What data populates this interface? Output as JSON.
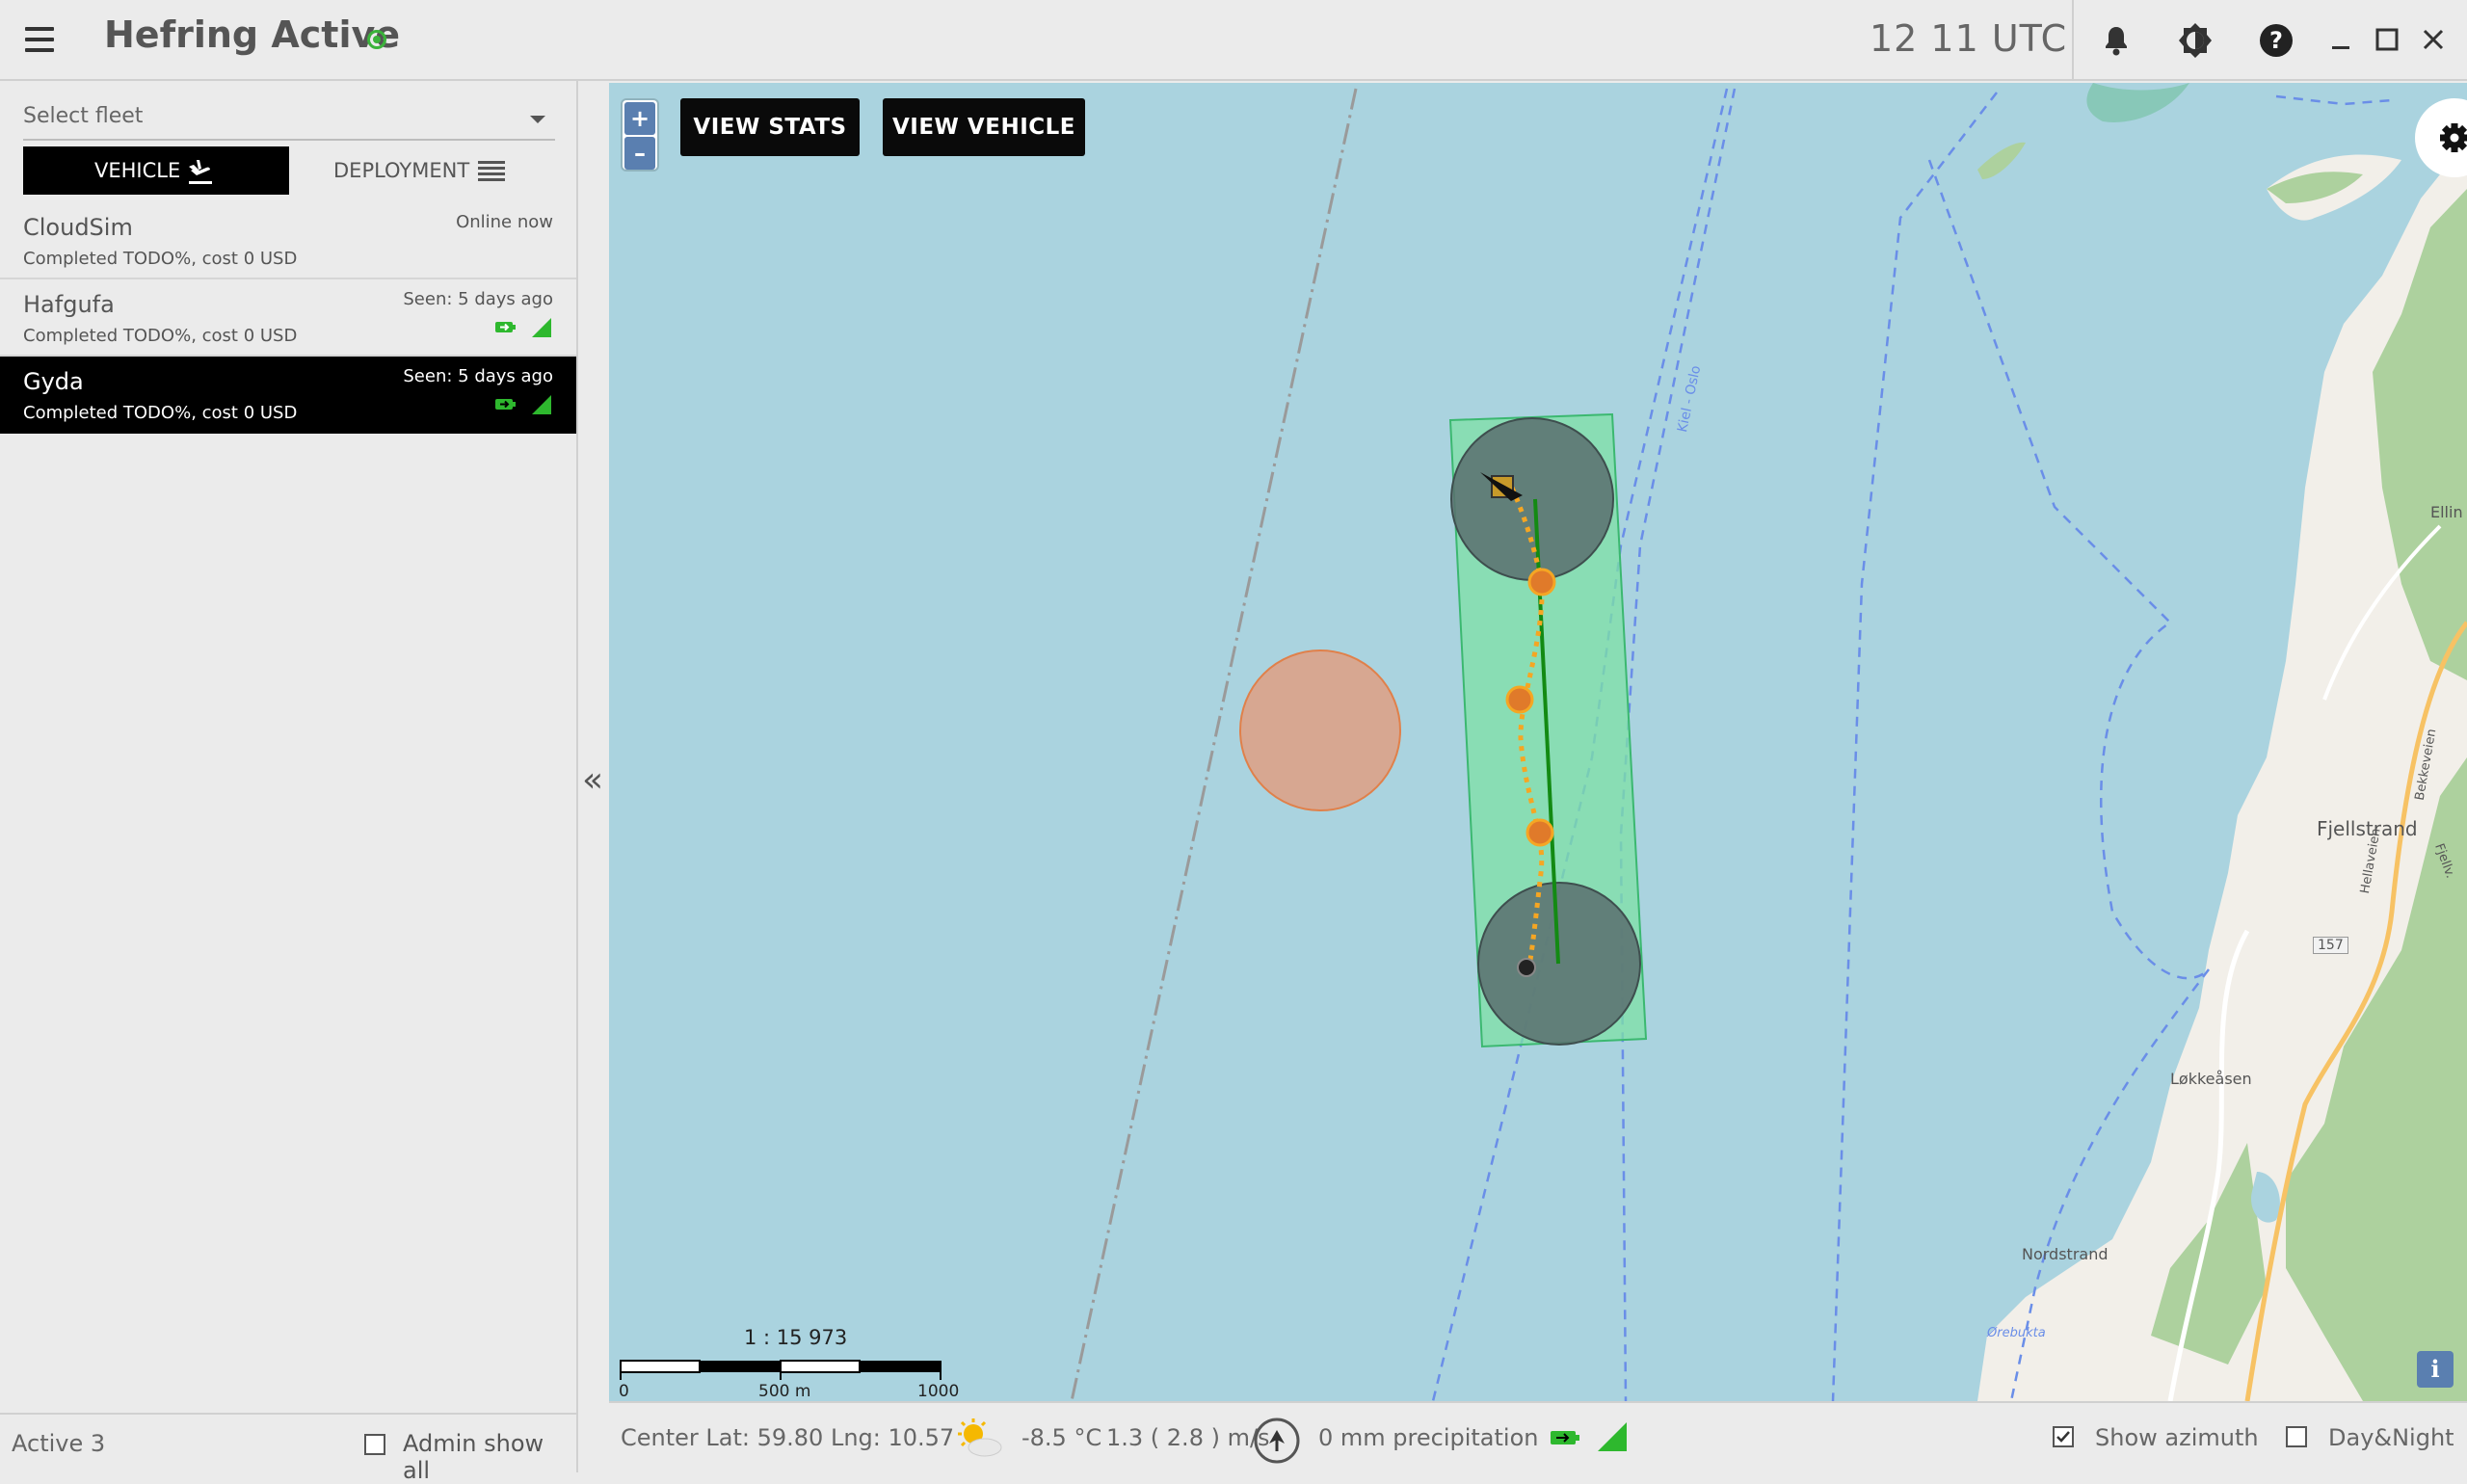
{
  "header": {
    "title": "Hefring Active",
    "clock": "12  11 UTC",
    "icons": [
      "menu-icon",
      "bell-icon",
      "brightness-icon",
      "help-icon",
      "minimize-icon",
      "maximize-icon",
      "close-icon"
    ]
  },
  "sidebar": {
    "fleet_placeholder": "Select fleet",
    "tabs": [
      {
        "label": "VEHICLE",
        "icon": "landing-plane-icon",
        "active": true
      },
      {
        "label": "DEPLOYMENT",
        "icon": "list-icon",
        "active": false
      }
    ],
    "vehicles": [
      {
        "name": "CloudSim",
        "status": "Online now",
        "summary": "Completed TODO%, cost 0 USD",
        "selected": false,
        "show_icons": false
      },
      {
        "name": "Hafgufa",
        "status": "Seen: 5 days ago",
        "summary": "Completed TODO%, cost 0 USD",
        "selected": false,
        "show_icons": true
      },
      {
        "name": "Gyda",
        "status": "Seen: 5 days ago",
        "summary": "Completed TODO%, cost 0 USD",
        "selected": true,
        "show_icons": true
      }
    ],
    "footer": {
      "active_count": "Active 3",
      "admin_label": "Admin show all"
    }
  },
  "map": {
    "buttons": {
      "zoom_in": "+",
      "zoom_out": "–",
      "view_stats": "VIEW STATS",
      "view_vehicle": "VIEW VEHICLE"
    },
    "scale": {
      "ratio": "1 : 15 973",
      "ticks": [
        "0",
        "500 m",
        "1000 m"
      ]
    },
    "place_labels": [
      "Kiel - Oslo",
      "Fjellstrand",
      "Løkkeåsen",
      "Nordstrand",
      "Ellin",
      "157",
      "Bekkeveien",
      "Hellaveien",
      "Fjellv.",
      "Ørebukta"
    ],
    "colors": {
      "water": "#aad3df",
      "land": "#f2efe9",
      "forest": "#add19e",
      "mission_area": "#7ee0a5",
      "track": "#f5a623",
      "route": "#138a13",
      "hazard": "#d9a48c"
    }
  },
  "status_bar": {
    "center": "Center Lat: 59.80 Lng: 10.57",
    "weather_icon": "partly-sunny-icon",
    "temperature": "-8.5 °C",
    "wind": "1.3 ( 2.8 ) m/s",
    "precipitation": "0 mm precipitation",
    "show_azimuth_label": "Show azimuth",
    "show_azimuth_checked": true,
    "day_night_label": "Day&Night",
    "day_night_checked": false
  }
}
